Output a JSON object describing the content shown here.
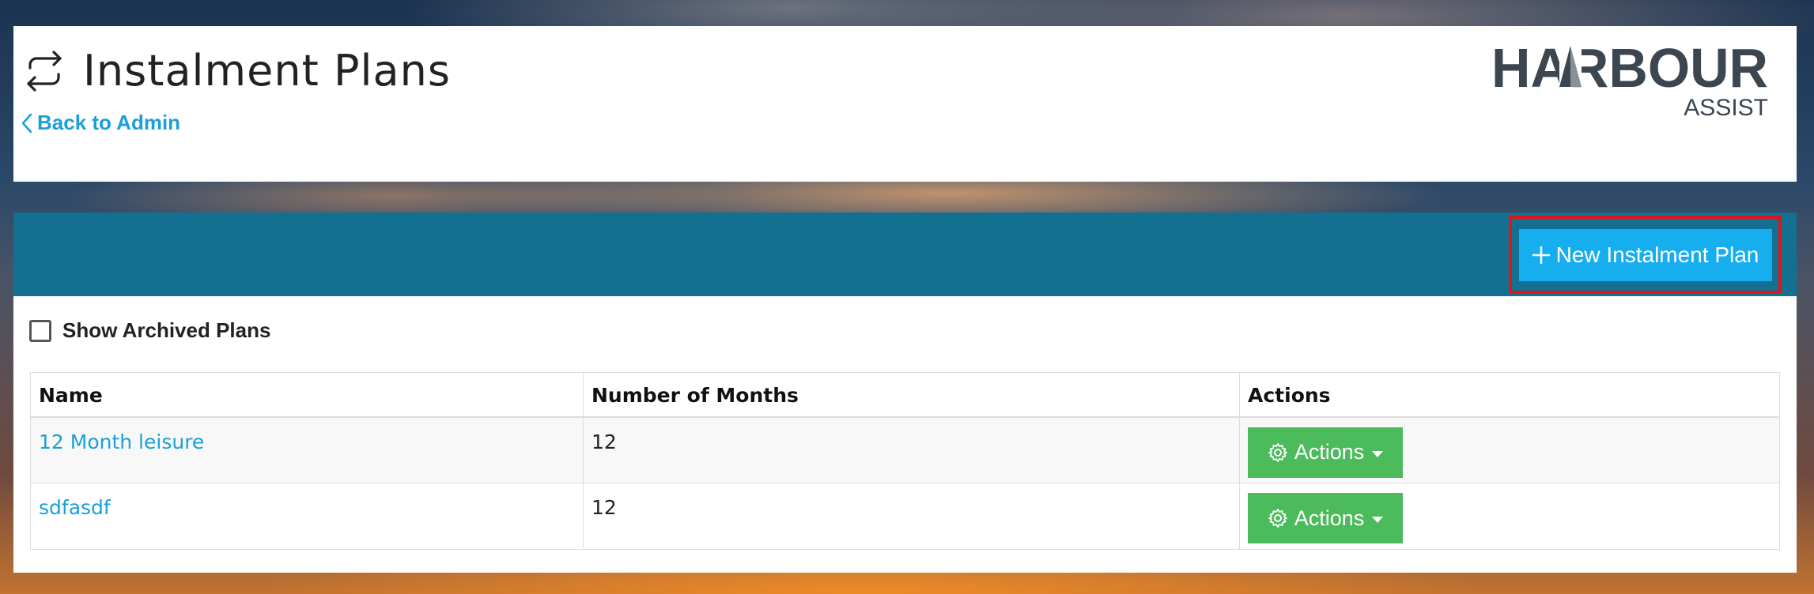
{
  "header": {
    "title": "Instalment Plans",
    "back_link": "Back to Admin",
    "title_icon": "repeat-arrows-icon",
    "logo": {
      "brand": "HARBOUR",
      "sub": "ASSIST"
    }
  },
  "toolbar": {
    "new_plan_label": "New Instalment Plan",
    "new_plan_icon": "plus-icon",
    "highlight_color": "#e0151b"
  },
  "filters": {
    "show_archived_label": "Show Archived Plans",
    "show_archived_checked": false
  },
  "table": {
    "columns": [
      "Name",
      "Number of Months",
      "Actions"
    ],
    "rows": [
      {
        "name": "12 Month leisure",
        "months": "12",
        "action_label": "Actions"
      },
      {
        "name": "sdfasdf",
        "months": "12",
        "action_label": "Actions"
      }
    ]
  },
  "colors": {
    "toolbar_bg": "#137090",
    "primary_button": "#17aef0",
    "action_button": "#4cbb5c",
    "link": "#1a9fd8"
  }
}
